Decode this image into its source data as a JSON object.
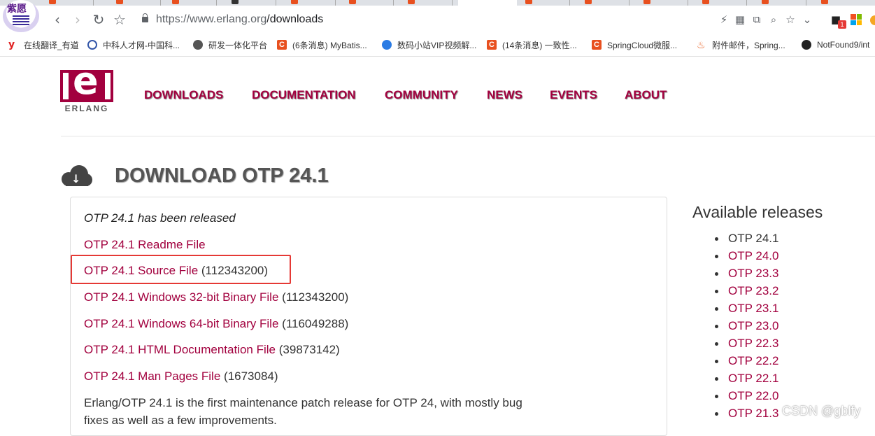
{
  "browser": {
    "url_host": "https://www.erlang.org",
    "url_path": "/downloads",
    "bookmarks": [
      {
        "label": "在线翻译_有道",
        "icon": "youdao-icon"
      },
      {
        "label": "中科人才网-中国科...",
        "icon": "round-logo-icon"
      },
      {
        "label": "研发一体化平台",
        "icon": "globe-icon"
      },
      {
        "label": "(6条消息) MyBatis...",
        "icon": "csdn-icon"
      },
      {
        "label": "数码小站VIP视频解...",
        "icon": "blue-logo-icon"
      },
      {
        "label": "(14条消息) 一致性...",
        "icon": "csdn-icon"
      },
      {
        "label": "SpringCloud微服...",
        "icon": "csdn-icon"
      },
      {
        "label": "附件邮件，Spring...",
        "icon": "fire-icon"
      },
      {
        "label": "NotFound9/int",
        "icon": "github-icon"
      }
    ],
    "extension_badge": "1"
  },
  "site": {
    "logo_text": "ERLANG",
    "nav": [
      "DOWNLOADS",
      "DOCUMENTATION",
      "COMMUNITY",
      "NEWS",
      "EVENTS",
      "ABOUT"
    ]
  },
  "main": {
    "title": "DOWNLOAD OTP 24.1",
    "released_note": "OTP 24.1 has been released",
    "downloads": [
      {
        "link": "OTP 24.1 Readme File",
        "size": ""
      },
      {
        "link": "OTP 24.1 Source File",
        "size": "(112343200)"
      },
      {
        "link": "OTP 24.1 Windows 32-bit Binary File",
        "size": "(112343200)"
      },
      {
        "link": "OTP 24.1 Windows 64-bit Binary File",
        "size": "(116049288)"
      },
      {
        "link": "OTP 24.1 HTML Documentation File",
        "size": "(39873142)"
      },
      {
        "link": "OTP 24.1 Man Pages File",
        "size": "(1673084)"
      }
    ],
    "description": "Erlang/OTP 24.1 is the first maintenance patch release for OTP 24, with mostly bug fixes as well as a few improvements."
  },
  "sidebar": {
    "title": "Available releases",
    "releases": [
      "OTP 24.1",
      "OTP 24.0",
      "OTP 23.3",
      "OTP 23.2",
      "OTP 23.1",
      "OTP 23.0",
      "OTP 22.3",
      "OTP 22.2",
      "OTP 22.1",
      "OTP 22.0",
      "OTP 21.3"
    ]
  },
  "watermark": "CSDN @gblfy",
  "colors": {
    "brand": "#a2003e",
    "highlight_box": "#e53935"
  }
}
